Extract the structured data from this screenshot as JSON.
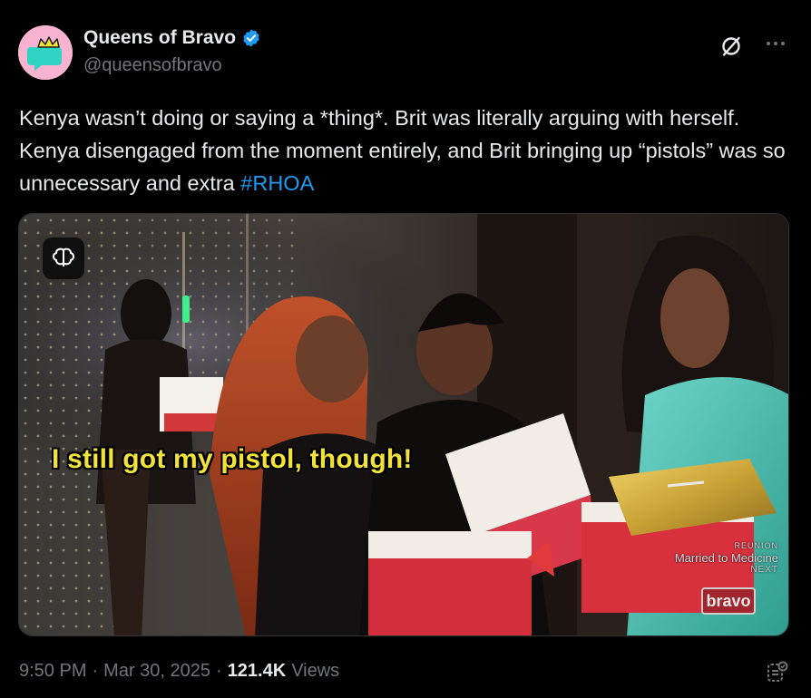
{
  "author": {
    "display_name": "Queens of Bravo",
    "handle": "@queensofbravo",
    "avatar_icon": "crown-chat-bubble-icon",
    "verified_color": "#1d9bf0"
  },
  "tweet": {
    "text_before_hashtag": "Kenya wasn’t doing or saying a *thing*. Brit was literally arguing with herself. Kenya disengaged from the moment entirely, and Brit bringing up “pistols” was so unnecessary and extra ",
    "hashtag": "#RHOA"
  },
  "media": {
    "subtitle": "I still got my pistol, though!",
    "promo_top": "REUNION",
    "promo_show": "Married to Medicine",
    "promo_bottom": "NEXT",
    "network_logo": "bravo",
    "badge_icon": "brain-icon"
  },
  "meta": {
    "time": "9:50 PM",
    "date": "Mar 30, 2025",
    "views_count": "121.4K",
    "views_label": "Views",
    "separator": "·"
  },
  "colors": {
    "background": "#000000",
    "text": "#e7e9ea",
    "secondary": "#71767b",
    "accent": "#1d9bf0",
    "subtitle": "#f2e33b"
  }
}
